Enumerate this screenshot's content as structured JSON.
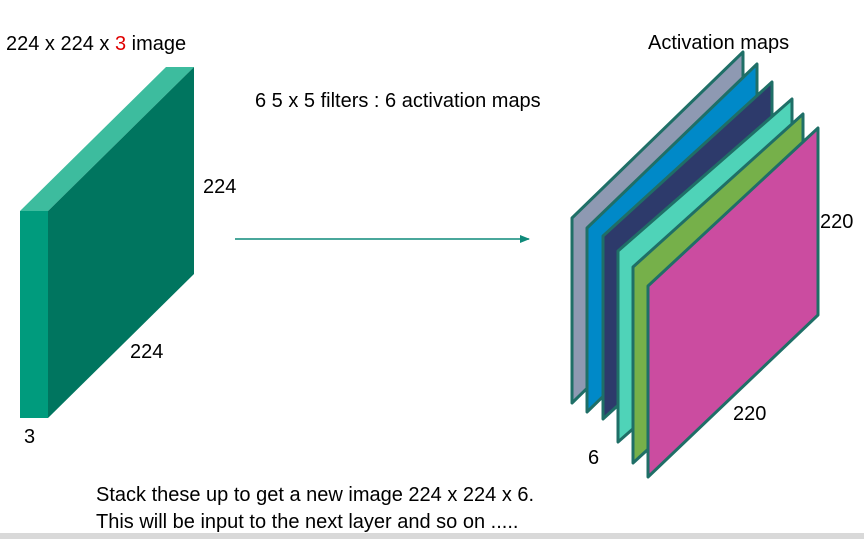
{
  "input_volume": {
    "title_prefix": "224 x 224 x ",
    "title_channels": "3",
    "title_suffix": " image",
    "height_label": "224",
    "width_label": "224",
    "depth_label": "3",
    "colors": {
      "front": "#009b7d",
      "side": "#00755f",
      "top": "#3dbc9e"
    }
  },
  "operation": {
    "text": "6  5 x 5 filters  : 6 activation maps",
    "arrow_color": "#0f8a7a"
  },
  "output_volume": {
    "title": "Activation maps",
    "title_color": "#3f5aa8",
    "height_label": "220",
    "width_label": "220",
    "count_label": "6",
    "count_color": "#e00000",
    "map_fill_colors": [
      "#8e99b2",
      "#0089c8",
      "#2d3a6b",
      "#4fd3b8",
      "#76b04a",
      "#cb4ca0"
    ],
    "map_edge_color": "#1f6f67"
  },
  "caption": {
    "line1": "Stack these up to get  a new image 224 x 224 x 6.",
    "line2": "This will be input to the next layer and so on ....."
  },
  "accent_red": "#e00000"
}
